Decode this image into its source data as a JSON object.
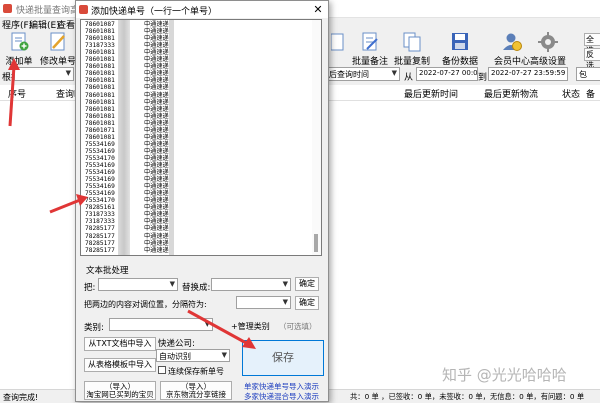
{
  "main": {
    "title": "快递批量查询高手",
    "menu": [
      "程序(F)",
      "编辑(E)",
      "查看("
    ],
    "toolbar": {
      "add": "添加单号",
      "modify": "修改单号",
      "batch_note": "批量备注",
      "batch_copy": "批量复制",
      "backup": "备份数据",
      "member": "会员中心",
      "advanced": "高级设置",
      "right1": "全选",
      "right2": "反选"
    },
    "filter": {
      "root_label": "根据",
      "time_mode": "后查询时间",
      "from_label": "从",
      "from_value": "2022-07-27 00:00:00",
      "to_label": "到",
      "to_value": "2022-07-27 23:59:59",
      "right_short": "包"
    },
    "columns": [
      "序号",
      "查询时",
      "最后更新时间",
      "最后更新物流",
      "状态",
      "备注"
    ],
    "status_left": "查询完成!",
    "status_right": "共：0 单 ，已签收：0 单，未签收：0 单，无信息：0 单，有问题：0 单",
    "watermark": "知乎 @光光哈哈哈"
  },
  "dialog": {
    "title": "添加快递单号（一行一个单号）",
    "close": "✕",
    "rows": [
      {
        "num": "78601087",
        "tag": "中通速递"
      },
      {
        "num": "78601081",
        "tag": "中通速递"
      },
      {
        "num": "78601081",
        "tag": "中通速递"
      },
      {
        "num": "73187333",
        "tag": "中通速递"
      },
      {
        "num": "78601081",
        "tag": "中通速递"
      },
      {
        "num": "78601081",
        "tag": "中通速递"
      },
      {
        "num": "78601081",
        "tag": "中通速递"
      },
      {
        "num": "78601081",
        "tag": "中通速递"
      },
      {
        "num": "78601081",
        "tag": "中通速递"
      },
      {
        "num": "78601081",
        "tag": "中通速递"
      },
      {
        "num": "78601081",
        "tag": "中通速递"
      },
      {
        "num": "78601081",
        "tag": "中通速递"
      },
      {
        "num": "78601081",
        "tag": "中通速递"
      },
      {
        "num": "78601081",
        "tag": "中通速递"
      },
      {
        "num": "78601081",
        "tag": "中通速递"
      },
      {
        "num": "78601071",
        "tag": "中通速递"
      },
      {
        "num": "78601081",
        "tag": "中通速递"
      },
      {
        "num": "75534169",
        "tag": "中通速递"
      },
      {
        "num": "75534169",
        "tag": "中通速递"
      },
      {
        "num": "75534170",
        "tag": "中通速递"
      },
      {
        "num": "75534169",
        "tag": "中通速递"
      },
      {
        "num": "75534169",
        "tag": "中通速递"
      },
      {
        "num": "75534169",
        "tag": "中通速递"
      },
      {
        "num": "75534169",
        "tag": "中通速递"
      },
      {
        "num": "75534169",
        "tag": "中通速递"
      },
      {
        "num": "75534170",
        "tag": "中通速递"
      },
      {
        "num": "78285161",
        "tag": "中通速递"
      },
      {
        "num": "73187333",
        "tag": "中通速递"
      },
      {
        "num": "73187333",
        "tag": "中通速递"
      },
      {
        "num": "78285177",
        "tag": "中通速递"
      },
      {
        "num": "78285177",
        "tag": "中通速递"
      },
      {
        "num": "78285177",
        "tag": "中通速递"
      },
      {
        "num": "78285177",
        "tag": "中通速递"
      }
    ],
    "text_processing": "文本批处理",
    "replace_label": "把:",
    "replace_with": "替换成:",
    "confirm": "确定",
    "align_label": "把两边的内容对调位置，分隔符为:",
    "category_label": "类别:",
    "manage_category": "+管理类别",
    "optional": "（可选填）",
    "import_txt": "从TXT文档中导入",
    "import_table": "从表格模板中导入",
    "courier_label": "快递公司:",
    "courier_value": "自动识别",
    "save_continue": "连续保存新单号",
    "save": "保存",
    "import_taobao_a": "（导入）",
    "import_taobao_b": "淘宝网已买到的宝贝",
    "import_jd_a": "（导入）",
    "import_jd_b": "京东物流分享链接",
    "link1": "单家快递单号导入演示",
    "link2": "多家快递混合导入演示"
  }
}
